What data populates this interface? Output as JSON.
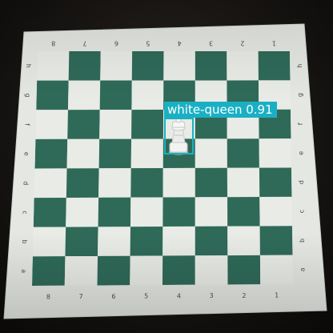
{
  "board": {
    "rank_labels": [
      "8",
      "7",
      "6",
      "5",
      "4",
      "3",
      "2",
      "1"
    ],
    "file_labels": [
      "h",
      "g",
      "f",
      "e",
      "d",
      "c",
      "b",
      "a"
    ],
    "dark_color": "#2f6a59",
    "light_color": "#e8ebe6"
  },
  "detection": {
    "class_name": "white-queen",
    "confidence": "0.91",
    "label": "white-queen 0.91",
    "color": "#1ab0c4"
  }
}
